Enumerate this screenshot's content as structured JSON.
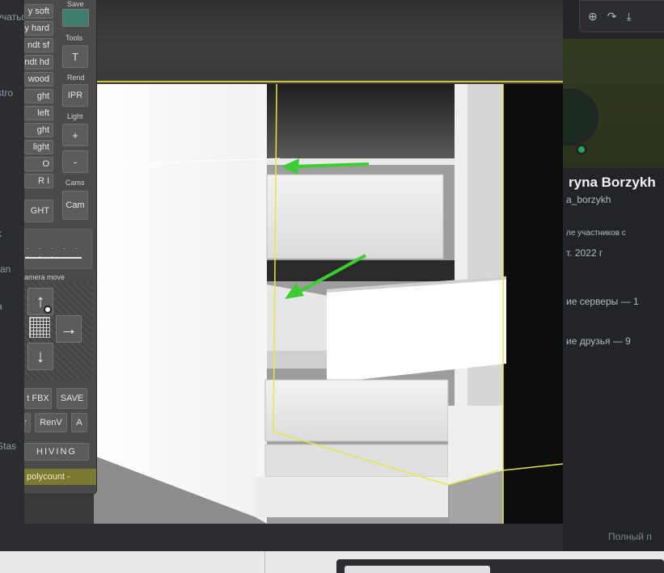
{
  "background_left_texts": [
    "учатьс",
    "stro",
    "k",
    "ran",
    "a",
    "Stas"
  ],
  "discord_toolbar": {
    "zoom_icon": "zoom-in-icon",
    "share_icon": "share-arrow-icon",
    "download_icon": "download-icon"
  },
  "profile": {
    "name": "ryna Borzykh",
    "username": "a_borzykh",
    "member_since_label": "ле участников с",
    "member_since_value": "т. 2022 г",
    "mutual_servers": "ие серверы — 1",
    "mutual_friends": "ие друзья — 9",
    "full_profile": "Полный п"
  },
  "panel": {
    "left_column": [
      "y soft",
      "y hard",
      "ndt sf",
      "ndt hd",
      "wood",
      "ght",
      "left",
      "ght",
      "light",
      "O",
      "R I"
    ],
    "light_button": "GHT",
    "save_label": "Save",
    "tools_label": "Tools",
    "tools_button": "T",
    "rend_label": "Rend",
    "rend_button": "IPR",
    "light_label": "Light",
    "light_plus": "+",
    "light_minus": "-",
    "cams_label": "Cams",
    "cams_button": "Cam",
    "slider_dots": ". . . . . . . .",
    "camera_move_label": "amera move",
    "up_arrow": "↑",
    "right_arrow": "→",
    "down_arrow": "↓",
    "fbx_button": "t FBX",
    "save_button": "SAVE",
    "r_button": "r",
    "renv_button": "RenV",
    "a_button": "A",
    "archiving_button": "HIVING",
    "polycount": "polycount -"
  },
  "colors": {
    "save_swatch": "#3f7e6e",
    "selection_outline": "#e6e64a",
    "arrow": "#3ccc33",
    "polycount_bg": "#7a7a30"
  }
}
